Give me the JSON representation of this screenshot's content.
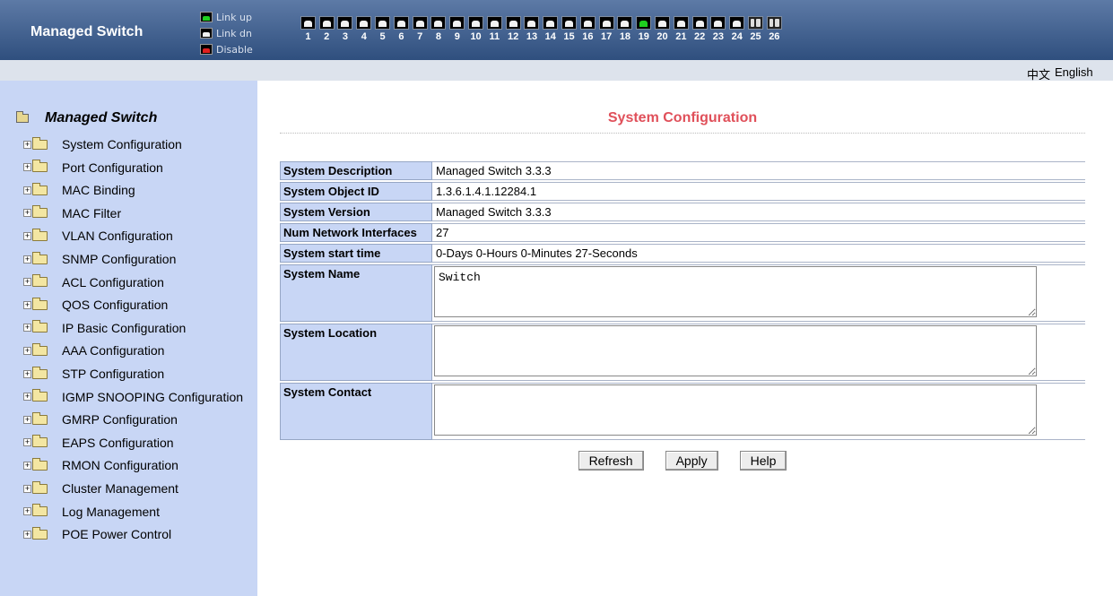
{
  "header": {
    "brand": "Managed Switch",
    "legend": [
      {
        "label": "Link up",
        "color": "#1fd01f"
      },
      {
        "label": "Link dn",
        "color": "#f2f2f2"
      },
      {
        "label": "Disable",
        "color": "#e02020"
      }
    ],
    "ports": [
      {
        "num": "1",
        "state": "down"
      },
      {
        "num": "2",
        "state": "down"
      },
      {
        "num": "3",
        "state": "down"
      },
      {
        "num": "4",
        "state": "down"
      },
      {
        "num": "5",
        "state": "down"
      },
      {
        "num": "6",
        "state": "down"
      },
      {
        "num": "7",
        "state": "down"
      },
      {
        "num": "8",
        "state": "down"
      },
      {
        "num": "9",
        "state": "down"
      },
      {
        "num": "10",
        "state": "down"
      },
      {
        "num": "11",
        "state": "down"
      },
      {
        "num": "12",
        "state": "down"
      },
      {
        "num": "13",
        "state": "down"
      },
      {
        "num": "14",
        "state": "down"
      },
      {
        "num": "15",
        "state": "down"
      },
      {
        "num": "16",
        "state": "down"
      },
      {
        "num": "17",
        "state": "down"
      },
      {
        "num": "18",
        "state": "down"
      },
      {
        "num": "19",
        "state": "up"
      },
      {
        "num": "20",
        "state": "down"
      },
      {
        "num": "21",
        "state": "down"
      },
      {
        "num": "22",
        "state": "down"
      },
      {
        "num": "23",
        "state": "down"
      },
      {
        "num": "24",
        "state": "down"
      },
      {
        "num": "25",
        "state": "fiber"
      },
      {
        "num": "26",
        "state": "fiber"
      }
    ]
  },
  "lang": {
    "zh": "中文",
    "en": "English"
  },
  "sidebar": {
    "root": "Managed Switch",
    "items": [
      "System Configuration",
      "Port Configuration",
      "MAC Binding",
      "MAC Filter",
      "VLAN Configuration",
      "SNMP Configuration",
      "ACL Configuration",
      "QOS Configuration",
      "IP Basic Configuration",
      "AAA Configuration",
      "STP Configuration",
      "IGMP SNOOPING Configuration",
      "GMRP Configuration",
      "EAPS Configuration",
      "RMON Configuration",
      "Cluster Management",
      "Log Management",
      "POE Power Control"
    ]
  },
  "main": {
    "title": "System Configuration",
    "rows": {
      "description": {
        "label": "System Description",
        "value": "Managed Switch 3.3.3"
      },
      "object_id": {
        "label": "System Object ID",
        "value": "1.3.6.1.4.1.12284.1"
      },
      "version": {
        "label": "System Version",
        "value": "Managed Switch 3.3.3"
      },
      "interfaces": {
        "label": "Num Network Interfaces",
        "value": "27"
      },
      "start_time": {
        "label": "System start time",
        "value": "0-Days 0-Hours 0-Minutes 27-Seconds"
      },
      "name": {
        "label": "System Name",
        "value": "Switch"
      },
      "location": {
        "label": "System Location",
        "value": ""
      },
      "contact": {
        "label": "System Contact",
        "value": ""
      }
    },
    "buttons": {
      "refresh": "Refresh",
      "apply": "Apply",
      "help": "Help"
    }
  }
}
